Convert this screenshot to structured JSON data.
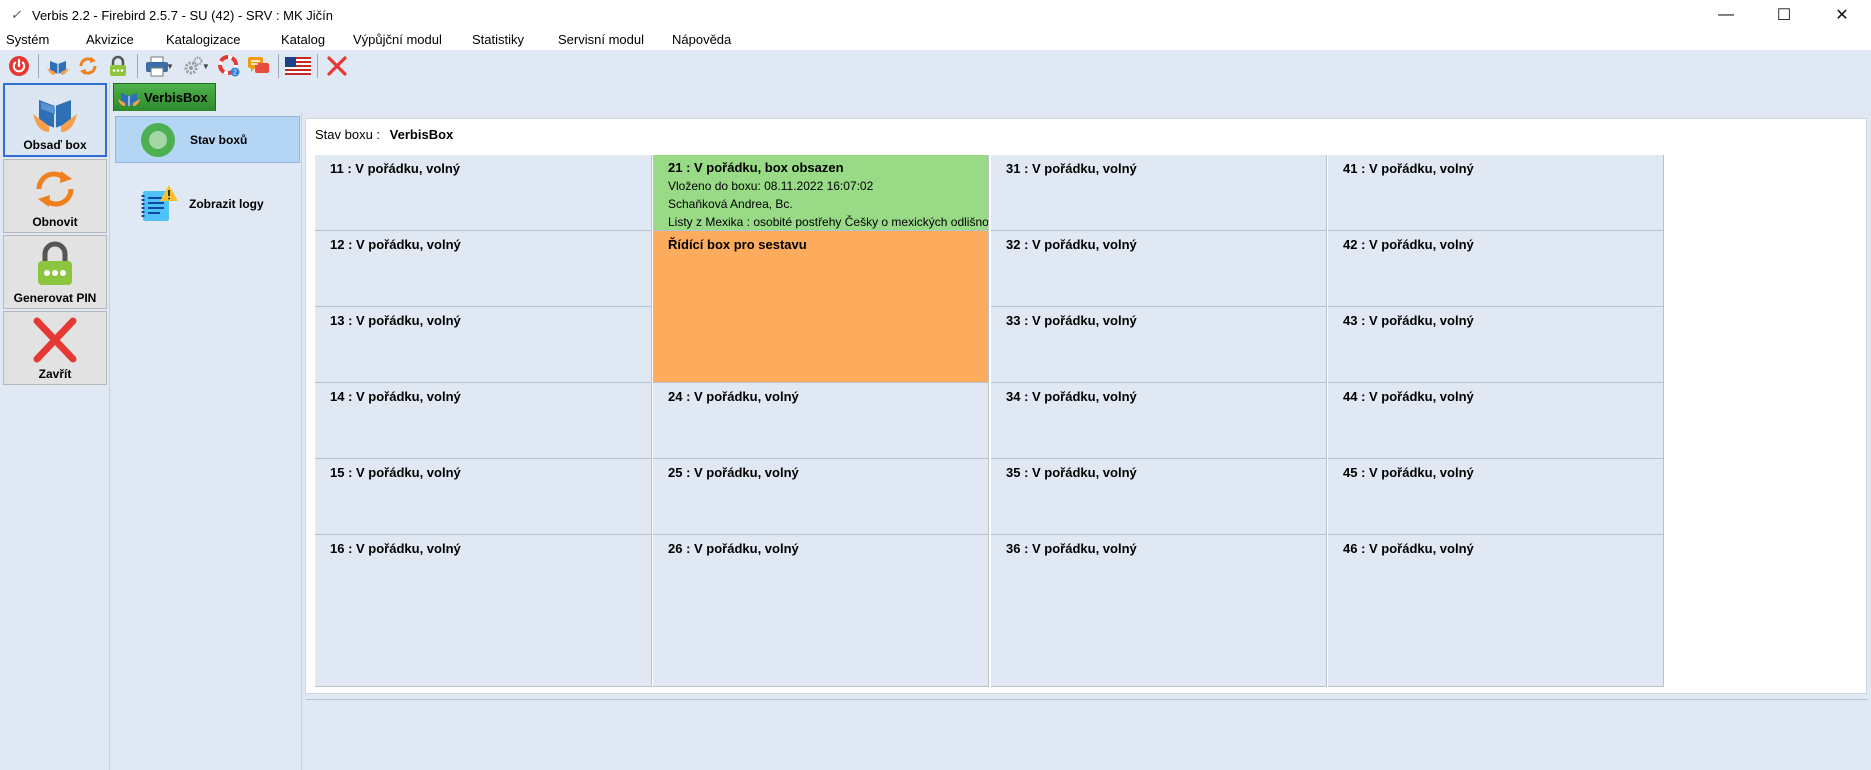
{
  "window": {
    "title": "Verbis 2.2 - Firebird 2.5.7 - SU (42) - SRV : MK Jičín",
    "minimize": "—",
    "maximize": "☐",
    "close": "✕"
  },
  "menu": [
    "Systém",
    "Akvizice",
    "Katalogizace",
    "Katalog",
    "Výpůjční modul",
    "Statistiky",
    "Servisní modul",
    "Nápověda"
  ],
  "toolbar": {
    "icons": [
      "power-icon",
      "book-hands-icon",
      "refresh-icon",
      "lock-pin-icon",
      "printer-icon",
      "settings-icon",
      "lifebuoy-icon",
      "chat-icon",
      "us-flag-icon",
      "close-icon"
    ]
  },
  "leftbar": {
    "buttons": [
      {
        "label": "Obsaď box",
        "active": true
      },
      {
        "label": "Obnovit"
      },
      {
        "label": "Generovat PIN"
      },
      {
        "label": "Zavřít"
      }
    ]
  },
  "tab": {
    "label": "VerbisBox"
  },
  "nav": {
    "items": [
      {
        "label": "Stav boxů",
        "selected": true
      },
      {
        "label": "Zobrazit logy"
      }
    ]
  },
  "content": {
    "status_prefix": "Stav boxu :",
    "status_value": "VerbisBox"
  },
  "colors": {
    "occupied": "#98da86",
    "control": "#fdac5d",
    "free": "#dfe8f3"
  },
  "boxes": {
    "col1": [
      "11 : V pořádku, volný",
      "12 : V pořádku, volný",
      "13 : V pořádku, volný",
      "14 : V pořádku, volný",
      "15 : V pořádku, volný",
      "16 : V pořádku, volný"
    ],
    "col2": {
      "box21": {
        "title": "21 : V pořádku, box obsazen",
        "line1": "Vloženo do boxu: 08.11.2022 16:07:02",
        "line2": "Schaňková Andrea, Bc.",
        "line3": "Listy z Mexika : osobité postřehy Češky o mexických odlišnostech /"
      },
      "control": "Řídící box pro sestavu",
      "rest": [
        "24 : V pořádku, volný",
        "25 : V pořádku, volný",
        "26 : V pořádku, volný"
      ]
    },
    "col3": [
      "31 : V pořádku, volný",
      "32 : V pořádku, volný",
      "33 : V pořádku, volný",
      "34 : V pořádku, volný",
      "35 : V pořádku, volný",
      "36 : V pořádku, volný"
    ],
    "col4": [
      "41 : V pořádku, volný",
      "42 : V pořádku, volný",
      "43 : V pořádku, volný",
      "44 : V pořádku, volný",
      "45 : V pořádku, volný",
      "46 : V pořádku, volný"
    ]
  }
}
